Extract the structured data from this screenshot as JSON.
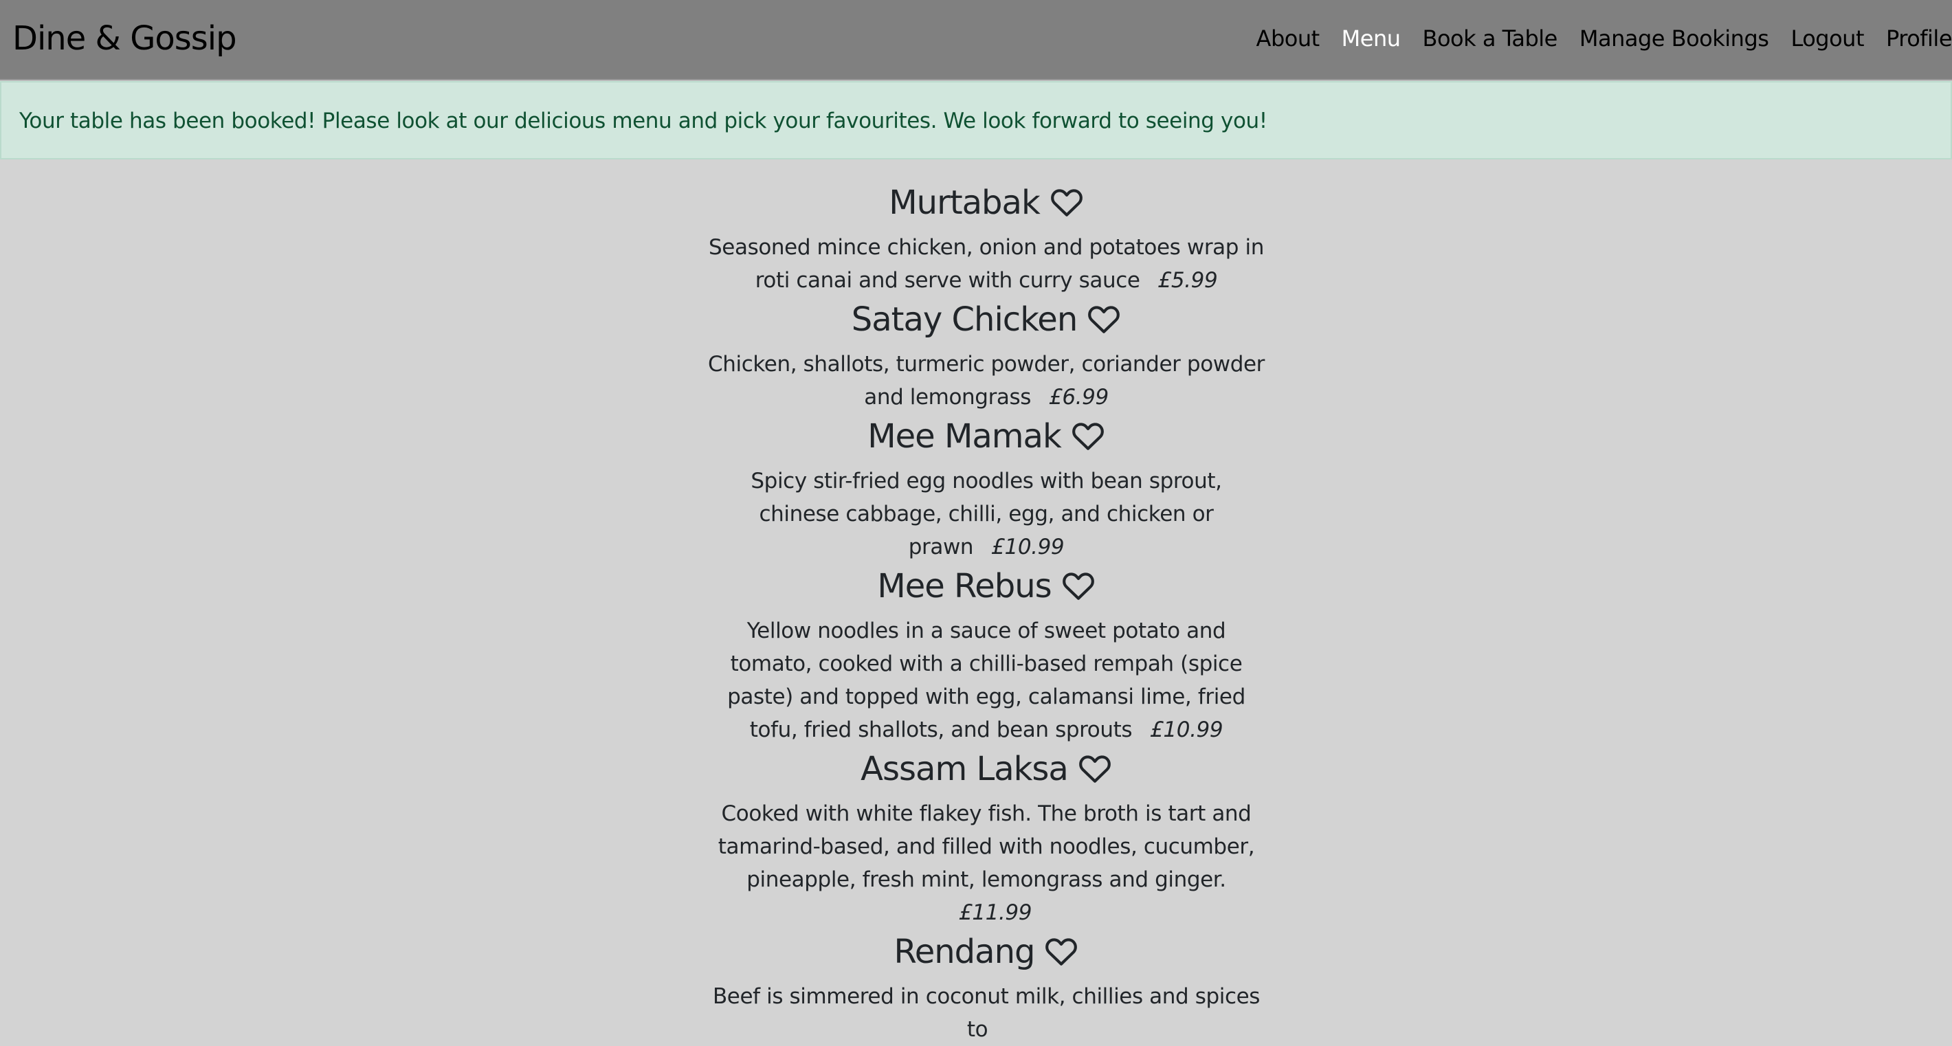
{
  "navbar": {
    "brand": "Dine & Gossip",
    "links": [
      {
        "label": "About"
      },
      {
        "label": "Menu"
      },
      {
        "label": "Book a Table"
      },
      {
        "label": "Manage Bookings"
      },
      {
        "label": "Logout"
      },
      {
        "label": "Profile"
      }
    ],
    "active": "Menu"
  },
  "alert": {
    "message": "Your table has been booked! Please look at our delicious menu and pick your favourites. We look forward to seeing you!"
  },
  "menu": {
    "items": [
      {
        "name": "Murtabak",
        "description": "Seasoned mince chicken, onion and potatoes wrap in roti canai and serve with curry sauce",
        "price": "£5.99"
      },
      {
        "name": "Satay Chicken",
        "description": "Chicken, shallots, turmeric powder, coriander powder and lemongrass",
        "price": "£6.99"
      },
      {
        "name": "Mee Mamak",
        "description": "Spicy stir-fried egg noodles with bean sprout, chinese cabbage, chilli, egg, and chicken or prawn",
        "price": "£10.99"
      },
      {
        "name": "Mee Rebus",
        "description": "Yellow noodles in a sauce of sweet potato and tomato, cooked with a chilli-based rempah (spice paste) and topped with egg, calamansi lime, fried tofu, fried shallots, and bean sprouts",
        "price": "£10.99"
      },
      {
        "name": "Assam Laksa",
        "description": "Cooked with white flakey fish. The broth is tart and tamarind-based, and filled with noodles, cucumber, pineapple, fresh mint, lemongrass and ginger.",
        "price": "£11.99"
      },
      {
        "name": "Rendang",
        "description": "Beef is simmered in coconut milk, chillies and spices to",
        "price": ""
      }
    ]
  },
  "colors": {
    "navbar_bg": "#808080",
    "page_bg": "#d3d3d3",
    "alert_bg": "#d1e7dd",
    "alert_text": "#0f5132",
    "active_link": "#ffffff"
  },
  "icons": {
    "favourite": "heart-outline-icon"
  }
}
